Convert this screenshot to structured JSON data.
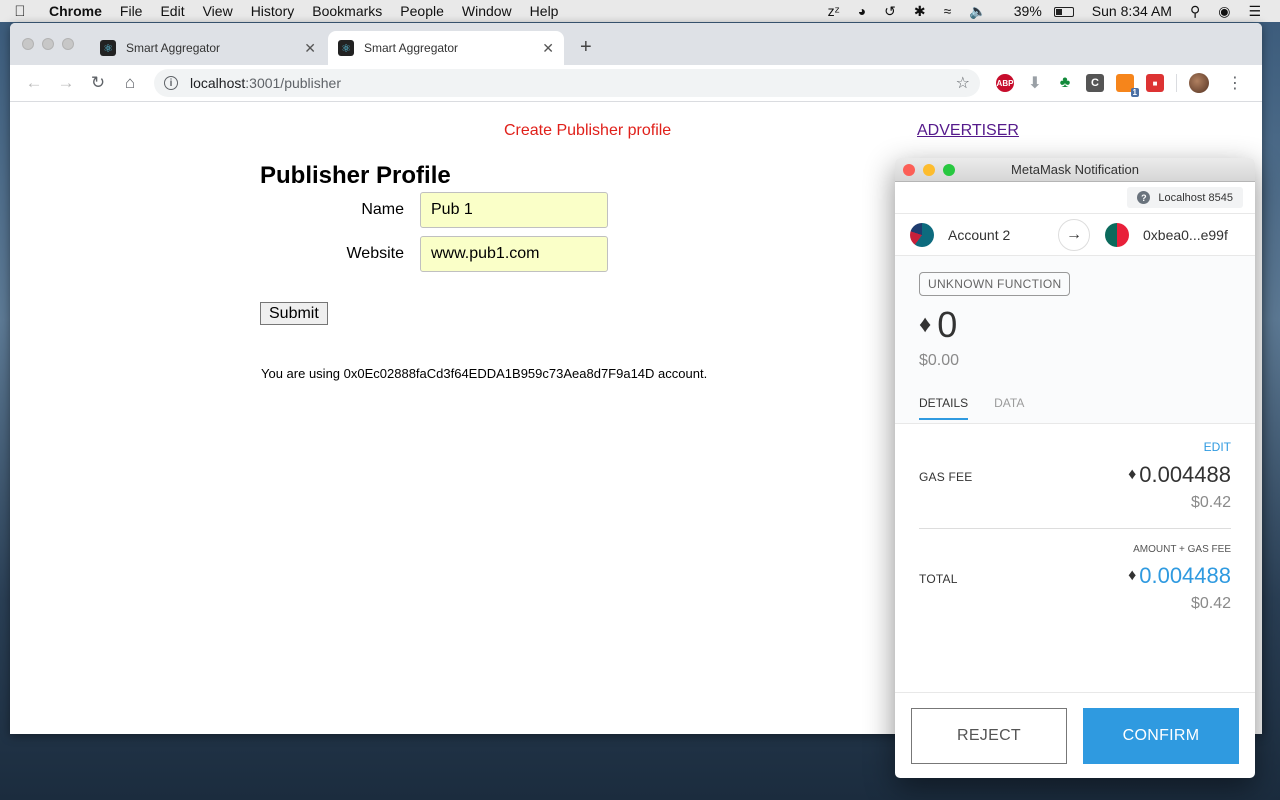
{
  "menubar": {
    "apple": "",
    "app": "Chrome",
    "items": [
      "File",
      "Edit",
      "View",
      "History",
      "Bookmarks",
      "People",
      "Window",
      "Help"
    ],
    "battery": "39%",
    "clock": "Sun 8:34 AM"
  },
  "browser": {
    "tabs": [
      {
        "title": "Smart Aggregator"
      },
      {
        "title": "Smart Aggregator"
      }
    ],
    "url_host": "localhost",
    "url_path": ":3001/publisher",
    "ext_abp": "ABP",
    "ext_c": "C",
    "ext_badge": "1"
  },
  "page": {
    "nav_create": "Create Publisher profile",
    "nav_advertiser": "ADVERTISER",
    "title": "Publisher Profile",
    "name_label": "Name",
    "name_value": "Pub 1",
    "website_label": "Website",
    "website_value": "www.pub1.com",
    "submit_label": "Submit",
    "account_text": "You are using 0x0Ec02888faCd3f64EDDA1B959c73Aea8d7F9a14D account."
  },
  "metamask": {
    "window_title": "MetaMask Notification",
    "network": "Localhost 8545",
    "from_account": "Account 2",
    "to_account": "0xbea0...e99f",
    "function_tag": "UNKNOWN FUNCTION",
    "amount": "0",
    "amount_fiat": "$0.00",
    "tab_details": "DETAILS",
    "tab_data": "DATA",
    "edit_label": "EDIT",
    "gas_fee_label": "GAS FEE",
    "gas_fee_value": "0.004488",
    "gas_fee_fiat": "$0.42",
    "amount_plus_gas_label": "AMOUNT + GAS FEE",
    "total_label": "TOTAL",
    "total_value": "0.004488",
    "total_fiat": "$0.42",
    "reject_label": "REJECT",
    "confirm_label": "CONFIRM",
    "accent_color": "#2f9ae0"
  }
}
